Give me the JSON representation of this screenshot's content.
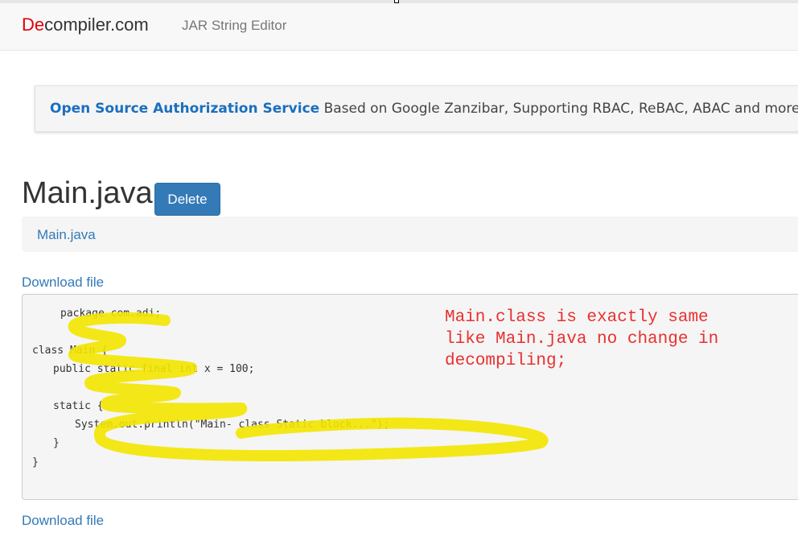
{
  "navbar": {
    "brand_accent": "De",
    "brand_rest": "compiler.com",
    "link": "JAR String Editor"
  },
  "banner": {
    "link_text": "Open Source Authorization Service",
    "text": " Based on Google Zanzibar, Supporting RBAC, ReBAC, ABAC and more."
  },
  "file": {
    "title": "Main.java",
    "delete_label": "Delete",
    "breadcrumb": "Main.java",
    "download_label": "Download file"
  },
  "code_lines": [
    "package com.adi;",
    "class Main {",
    "public static final int x = 100;",
    "static {",
    "System.out.println(\"Main- class Static block...\");",
    "}",
    "}"
  ],
  "annotation": {
    "lines": [
      "Main.class is exactly same",
      "like Main.java no change in",
      "decompiling;"
    ],
    "color": "#e8302f",
    "highlight_color": "#f3e500"
  },
  "colors": {
    "brand_red": "#e0000a",
    "link_blue": "#337ab7",
    "button_blue": "#337ab7"
  }
}
